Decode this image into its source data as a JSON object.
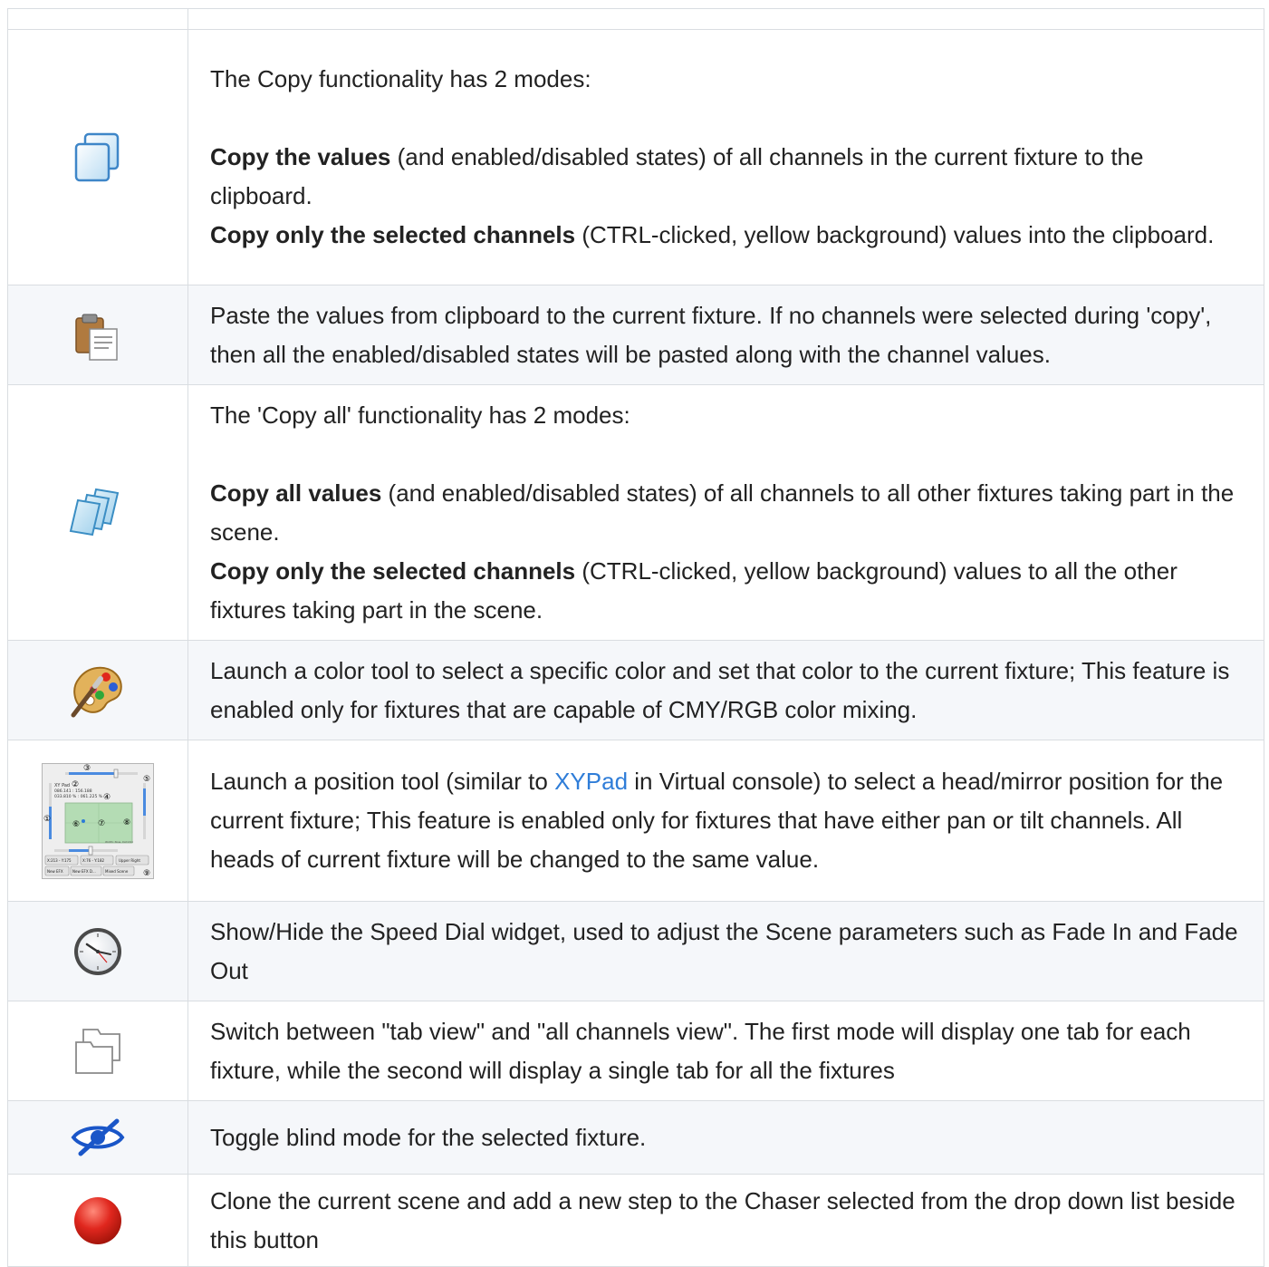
{
  "rows": [
    {
      "icon": "copy-icon",
      "intro": "The Copy functionality has 2 modes:",
      "mode1_bold": "Copy the values",
      "mode1_rest": " (and enabled/disabled states) of all channels in the current fixture to the clipboard.",
      "mode2_bold": "Copy only the selected channels",
      "mode2_rest": " (CTRL-clicked, yellow background) values into the clipboard."
    },
    {
      "icon": "paste-icon",
      "text": "Paste the values from clipboard to the current fixture. If no channels were selected during 'copy', then all the enabled/disabled states will be pasted along with the channel values."
    },
    {
      "icon": "copy-all-icon",
      "intro": "The 'Copy all' functionality has 2 modes:",
      "mode1_bold": "Copy all values",
      "mode1_rest": " (and enabled/disabled states) of all channels to all other fixtures taking part in the scene.",
      "mode2_bold": "Copy only the selected channels",
      "mode2_rest": " (CTRL-clicked, yellow background) values to all the other fixtures taking part in the scene."
    },
    {
      "icon": "color-palette-icon",
      "text": "Launch a color tool to select a specific color and set that color to the current fixture; This feature is enabled only for fixtures that are capable of CMY/RGB color mixing."
    },
    {
      "icon": "xy-pad-thumbnail",
      "text_before": "Launch a position tool (similar to ",
      "link": "XYPad",
      "text_after": " in Virtual console) to select a head/mirror position for the current fixture; This feature is enabled only for fixtures that have either pan or tilt channels. All heads of current fixture will be changed to the same value.",
      "thumbnail": {
        "title": "XY Pad",
        "line1": "086.141 : 156.188",
        "line2": "033.810 % : 061.225 %",
        "width_label": "Width: Now, Dot13m",
        "buttons_row1": [
          "X:213 - Y:175",
          "X:76 - Y:182",
          "Upper Right"
        ],
        "buttons_row2": [
          "New EFX",
          "New EFX D...",
          "Mixed Scene"
        ],
        "markers": [
          "①",
          "②",
          "③",
          "④",
          "⑤",
          "⑥",
          "⑦",
          "⑧",
          "⑨"
        ]
      }
    },
    {
      "icon": "clock-icon",
      "text": "Show/Hide the Speed Dial widget, used to adjust the Scene parameters such as Fade In and Fade Out"
    },
    {
      "icon": "tab-view-icon",
      "text": "Switch between \"tab view\" and \"all channels view\". The first mode will display one tab for each fixture, while the second will display a single tab for all the fixtures"
    },
    {
      "icon": "blind-eye-icon",
      "text": "Toggle blind mode for the selected fixture."
    },
    {
      "icon": "record-icon",
      "text": "Clone the current scene and add a new step to the Chaser selected from the drop down list beside this button"
    }
  ]
}
